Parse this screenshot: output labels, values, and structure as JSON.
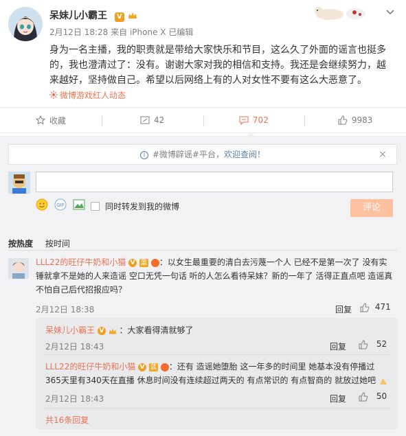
{
  "post": {
    "author": "呆妹儿小霸王",
    "badge": "V",
    "date": "2月12日 18:28",
    "source": "来自 iPhone X",
    "edited": "已编辑",
    "text": "身为一名主播，我的职责就是带给大家快乐和节目，这么久了外面的谣言也挺多的，我也澄清过了：没有。谢谢大家对我的相信和支持。我还是会继续努力，越来越好，坚持做自己。希望以后网络上有的人对女性不要有这么大恶意了。",
    "tag": "微博游戏红人动态"
  },
  "actions": [
    {
      "label": "收藏",
      "icon": "star-icon"
    },
    {
      "label": "42",
      "icon": "share-icon"
    },
    {
      "label": "702",
      "icon": "comment-icon"
    },
    {
      "label": "9983",
      "icon": "like-icon"
    }
  ],
  "notice": {
    "prefix": "#微博辟谣#平台，",
    "link": "欢迎查阅！"
  },
  "composer": {
    "forward_label": "同时转发到我的微博",
    "submit": "评论"
  },
  "sort": {
    "hot": "按热度",
    "time": "按时间"
  },
  "comments": [
    {
      "user": "LLL22的旺仔牛奶和小猫",
      "text": "：以女生最重要的清白去污蔑一个人 已经不是第一次了 没有实锤就拿不是她的人来造谣 空口无凭一句话 听的人怎么看待呆妹？新的一年了 活得正直点吧 造谣真不怕自己后代招报应吗？",
      "time": "2月12日 18:38",
      "reply": "回复",
      "likes": "471"
    }
  ],
  "replies": [
    {
      "user": "呆妹儿小霸王",
      "text": "：大家看得清就够了",
      "time": "2月12日 18:43",
      "reply": "回复",
      "likes": "52"
    },
    {
      "user": "LLL22的旺仔牛奶和小猫",
      "text": "：还有 造谣她堕胎 这一年多的时间里 她基本没有停播过365天里有340天在直播 休息时间没有连续超过两天的 有点常识的 有点智商的 就放过她吧",
      "time": "2月12日 18:43",
      "reply": "回复",
      "likes": "50"
    }
  ],
  "more_replies": "共16条回复",
  "colors": {
    "accent": "#eb7350",
    "panel": "#f2f2f5"
  }
}
